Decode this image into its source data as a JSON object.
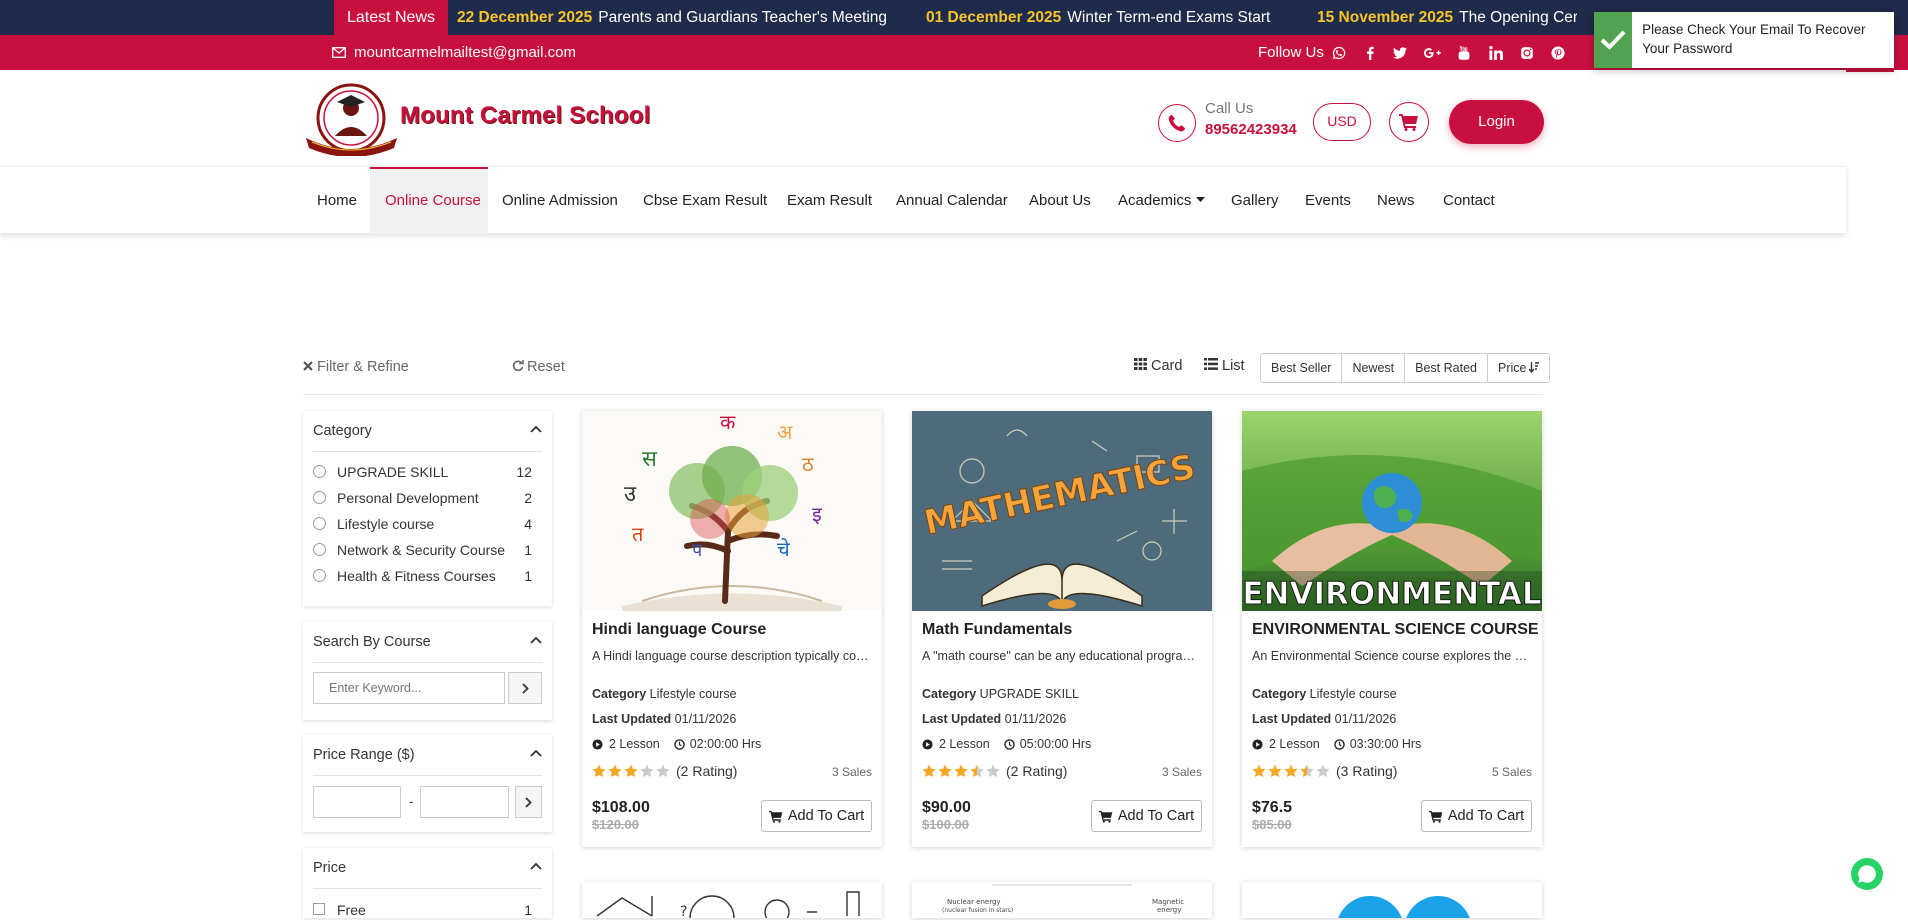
{
  "news": {
    "label": "Latest News",
    "items": [
      {
        "date": "22 December 2025",
        "text": "Parents and Guardians Teacher's Meeting"
      },
      {
        "date": "01 December 2025",
        "text": "Winter Term-end Exams Start"
      },
      {
        "date": "15 November 2025",
        "text": "The Opening Ceremo"
      }
    ]
  },
  "contact": {
    "email": "mountcarmelmailtest@gmail.com",
    "follow_label": "Follow Us",
    "social_icons": [
      "whatsapp-icon",
      "facebook-icon",
      "twitter-icon",
      "google-plus-icon",
      "youtube-icon",
      "linkedin-icon",
      "instagram-icon",
      "pinterest-icon"
    ]
  },
  "toast": {
    "message": "Please Check Your Email To Recover Your Password"
  },
  "header": {
    "brand": "Mount Carmel School",
    "call_label": "Call Us",
    "call_number": "89562423934",
    "currency": "USD",
    "login_label": "Login"
  },
  "nav": {
    "items": [
      "Home",
      "Online Course",
      "Online Admission",
      "Cbse Exam Result",
      "Exam Result",
      "Annual Calendar",
      "About Us",
      "Academics",
      "Gallery",
      "Events",
      "News",
      "Contact"
    ],
    "active": "Online Course"
  },
  "toolbar": {
    "filter_label": "Filter & Refine",
    "reset_label": "Reset",
    "card_label": "Card",
    "list_label": "List",
    "sort_options": [
      "Best Seller",
      "Newest",
      "Best Rated",
      "Price"
    ]
  },
  "sidebar": {
    "category": {
      "title": "Category",
      "items": [
        {
          "name": "UPGRADE SKILL",
          "count": "12"
        },
        {
          "name": "Personal Development",
          "count": "2"
        },
        {
          "name": "Lifestyle course",
          "count": "4"
        },
        {
          "name": "Network & Security Course",
          "count": "1"
        },
        {
          "name": "Health & Fitness Courses",
          "count": "1"
        }
      ]
    },
    "search": {
      "title": "Search By Course",
      "placeholder": "Enter Keyword..."
    },
    "price_range": {
      "title": "Price Range ($)",
      "separator": "-"
    },
    "price": {
      "title": "Price",
      "items": [
        {
          "name": "Free",
          "count": "1"
        }
      ]
    }
  },
  "courses": [
    {
      "title": "Hindi language Course",
      "desc": "A Hindi language course description typically covers the fundamentals of the language",
      "category_label": "Category",
      "category": "Lifestyle course",
      "updated_label": "Last Updated",
      "updated": "01/11/2026",
      "lessons": "2 Lesson",
      "duration": "02:00:00 Hrs",
      "rating": 3,
      "rating_text": "(2 Rating)",
      "sales": "3 Sales",
      "price": "$108.00",
      "old_price": "$120.00",
      "cart_label": "Add To Cart"
    },
    {
      "title": "Math Fundamentals",
      "desc": "A \"math course\" can be any educational program covering mathematical concepts",
      "category_label": "Category",
      "category": "UPGRADE SKILL",
      "updated_label": "Last Updated",
      "updated": "01/11/2026",
      "lessons": "2 Lesson",
      "duration": "05:00:00 Hrs",
      "rating": 3.5,
      "rating_text": "(2 Rating)",
      "sales": "3 Sales",
      "price": "$90.00",
      "old_price": "$100.00",
      "cart_label": "Add To Cart"
    },
    {
      "title": "ENVIRONMENTAL SCIENCE COURSE",
      "desc": "An Environmental Science course explores the natural world and human impact",
      "category_label": "Category",
      "category": "Lifestyle course",
      "updated_label": "Last Updated",
      "updated": "01/11/2026",
      "lessons": "2 Lesson",
      "duration": "03:30:00 Hrs",
      "rating": 3.5,
      "rating_text": "(3 Rating)",
      "sales": "5 Sales",
      "price": "$76.5",
      "old_price": "$85.00",
      "cart_label": "Add To Cart"
    }
  ],
  "colors": {
    "brand": "#c8103e",
    "navy": "#1f2b4a",
    "news_date": "#f8c42a",
    "toast_success": "#51a351"
  },
  "card_images": {
    "math_word": "MATHEMATICS",
    "env_word": "ENVIRONMENTAL"
  }
}
